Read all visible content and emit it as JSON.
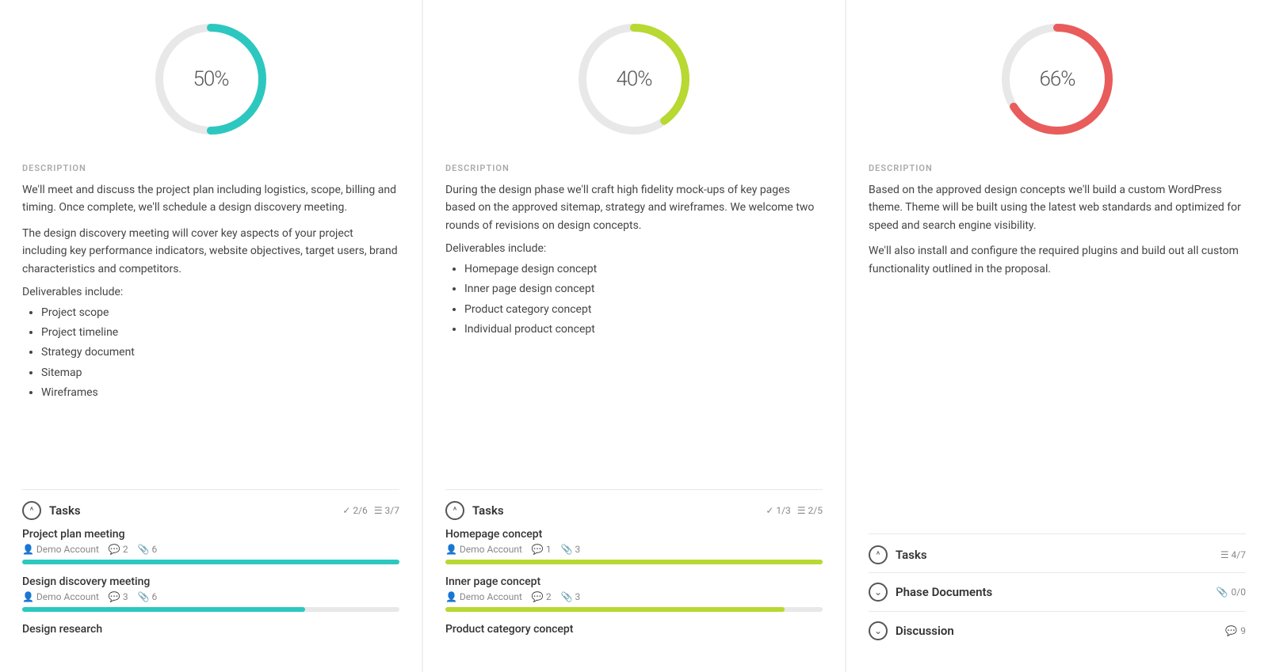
{
  "columns": [
    {
      "id": "col1",
      "percent": "50%",
      "percent_value": 50,
      "donut_color": "#2cc8c0",
      "description_label": "DESCRIPTION",
      "description": [
        "We'll meet and discuss the project plan including logistics, scope, billing and timing. Once complete, we'll schedule a design discovery meeting.",
        "The design discovery meeting will cover key aspects of your project including key performance indicators, website objectives, target users, brand characteristics and competitors."
      ],
      "deliverables_label": "Deliverables include:",
      "deliverables": [
        "Project scope",
        "Project timeline",
        "Strategy document",
        "Sitemap",
        "Wireframes"
      ],
      "tasks_label": "Tasks",
      "tasks_count1": "2/6",
      "tasks_count2": "3/7",
      "tasks": [
        {
          "name": "Project plan meeting",
          "assignee": "Demo Account",
          "comments": "2",
          "attachments": "6",
          "progress": 100,
          "bar_color": "#2cc8c0"
        },
        {
          "name": "Design discovery meeting",
          "assignee": "Demo Account",
          "comments": "3",
          "attachments": "6",
          "progress": 75,
          "bar_color": "#2cc8c0"
        },
        {
          "name": "Design research",
          "assignee": "",
          "comments": "",
          "attachments": "",
          "progress": 0,
          "bar_color": "#2cc8c0"
        }
      ]
    },
    {
      "id": "col2",
      "percent": "40%",
      "percent_value": 40,
      "donut_color": "#b8d832",
      "description_label": "DESCRIPTION",
      "description": [
        "During the design phase we'll craft high fidelity mock-ups of key pages based on the approved sitemap, strategy and wireframes. We welcome two rounds of revisions on design concepts."
      ],
      "deliverables_label": "Deliverables include:",
      "deliverables": [
        "Homepage design concept",
        "Inner page design concept",
        "Product category concept",
        "Individual product concept"
      ],
      "tasks_label": "Tasks",
      "tasks_count1": "1/3",
      "tasks_count2": "2/5",
      "tasks": [
        {
          "name": "Homepage concept",
          "assignee": "Demo Account",
          "comments": "1",
          "attachments": "3",
          "progress": 100,
          "bar_color": "#b8d832"
        },
        {
          "name": "Inner page concept",
          "assignee": "Demo Account",
          "comments": "2",
          "attachments": "3",
          "progress": 90,
          "bar_color": "#b8d832"
        },
        {
          "name": "Product category concept",
          "assignee": "",
          "comments": "",
          "attachments": "",
          "progress": 0,
          "bar_color": "#b8d832"
        }
      ]
    },
    {
      "id": "col3",
      "percent": "66%",
      "percent_value": 66,
      "donut_color": "#e85c5c",
      "description_label": "DESCRIPTION",
      "description": [
        "Based on the approved design concepts we'll build a custom WordPress theme. Theme will be built using the latest web standards and optimized for speed and search engine visibility.",
        "We'll also install and configure the required plugins and build out all custom functionality outlined in the proposal."
      ],
      "deliverables_label": "",
      "deliverables": [],
      "tasks_label": "Tasks",
      "tasks_count1": "",
      "tasks_count2": "4/7",
      "tasks": [],
      "extra_sections": [
        {
          "label": "Phase Documents",
          "meta": "0/0",
          "meta_icon": "📎"
        },
        {
          "label": "Discussion",
          "meta": "9",
          "meta_icon": "💬"
        }
      ]
    }
  ]
}
